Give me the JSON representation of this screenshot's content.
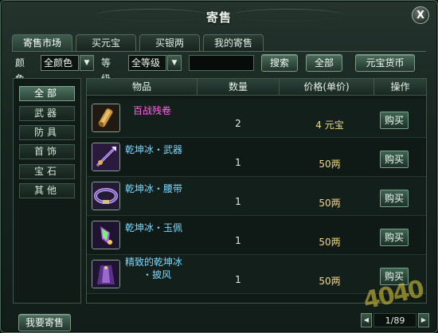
{
  "window": {
    "title": "寄售"
  },
  "tabs": [
    "寄售市场",
    "买元宝",
    "买银两",
    "我的寄售"
  ],
  "filters": {
    "color_label": "颜色",
    "color_value": "全颜色",
    "level_label": "等级",
    "level_value": "全等级",
    "search_placeholder": "",
    "search_button": "搜索",
    "all_button": "全部",
    "currency_button": "元宝货币"
  },
  "categories": [
    "全部",
    "武器",
    "防具",
    "首饰",
    "宝石",
    "其他"
  ],
  "table": {
    "headers": [
      "物品",
      "数量",
      "价格(单价)",
      "操作"
    ],
    "rows": [
      {
        "name": "百战残卷",
        "quantity": "2",
        "price": "4 元宝",
        "action": "购买",
        "icon": "scroll-icon",
        "name_color": "#ff66e6"
      },
      {
        "name": "乾坤冰・武器",
        "quantity": "1",
        "price": "50两",
        "action": "购买",
        "icon": "weapon-icon",
        "name_color": "#7fd8ff"
      },
      {
        "name": "乾坤冰・腰带",
        "quantity": "1",
        "price": "50两",
        "action": "购买",
        "icon": "belt-icon",
        "name_color": "#7fd8ff"
      },
      {
        "name": "乾坤冰・玉佩",
        "quantity": "1",
        "price": "50两",
        "action": "购买",
        "icon": "jade-pendant-icon",
        "name_color": "#7fd8ff"
      },
      {
        "name_line1": "精致的乾坤冰",
        "name_line2": "・披风",
        "quantity": "1",
        "price": "50两",
        "action": "购买",
        "icon": "cloak-icon",
        "name_color": "#7fd8ff"
      }
    ]
  },
  "footer": {
    "sell_button": "我要寄售",
    "page": "1/89"
  },
  "watermark": "4040",
  "colors": {
    "accent": "#3e6452",
    "price": "#f3d77e",
    "rare": "#ff66e6",
    "item": "#7fd8ff"
  }
}
